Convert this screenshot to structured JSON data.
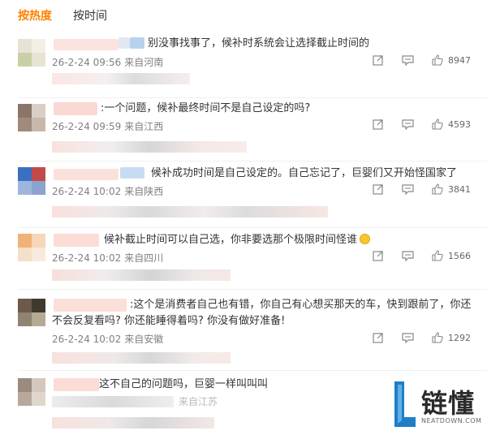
{
  "tabs": {
    "hot": "按热度",
    "time": "按时间"
  },
  "comments": [
    {
      "text": "别没事找事了，候补时系统会让选择截止时间的",
      "date": "26-2-24 09:56",
      "location": "来自河南",
      "likes": "8947"
    },
    {
      "text": ":一个问题，候补最终时间不是自己设定的吗?",
      "date": "26-2-24 09:59",
      "location": "来自江西",
      "likes": "4593"
    },
    {
      "text": "候补成功时间是自己设定的。自己忘记了，巨婴们又开始怪国家了",
      "date": "26-2-24 10:02",
      "location": "来自陕西",
      "likes": "3841"
    },
    {
      "text": "候补截止时间可以自己选，你非要选那个极限时间怪谁",
      "date": "26-2-24 10:02",
      "location": "来自四川",
      "likes": "1566"
    },
    {
      "text": ":这个是消费者自己也有错，你自己有心想买那天的车，快到跟前了，你还不会反复看吗? 你还能睡得着吗? 你没有做好准备!",
      "date": "26-2-24 10:02",
      "location": "来自安徽",
      "likes": "1292"
    },
    {
      "text": "这不自己的问题吗，巨婴一样叫叫叫",
      "location": "来自江苏"
    }
  ],
  "watermark": {
    "brand": "链懂",
    "sub": "NEATDOWN.COM"
  },
  "colors": {
    "accent": "#ff8200",
    "meta": "#808080",
    "watermark_blue": "#1f7ec6"
  }
}
